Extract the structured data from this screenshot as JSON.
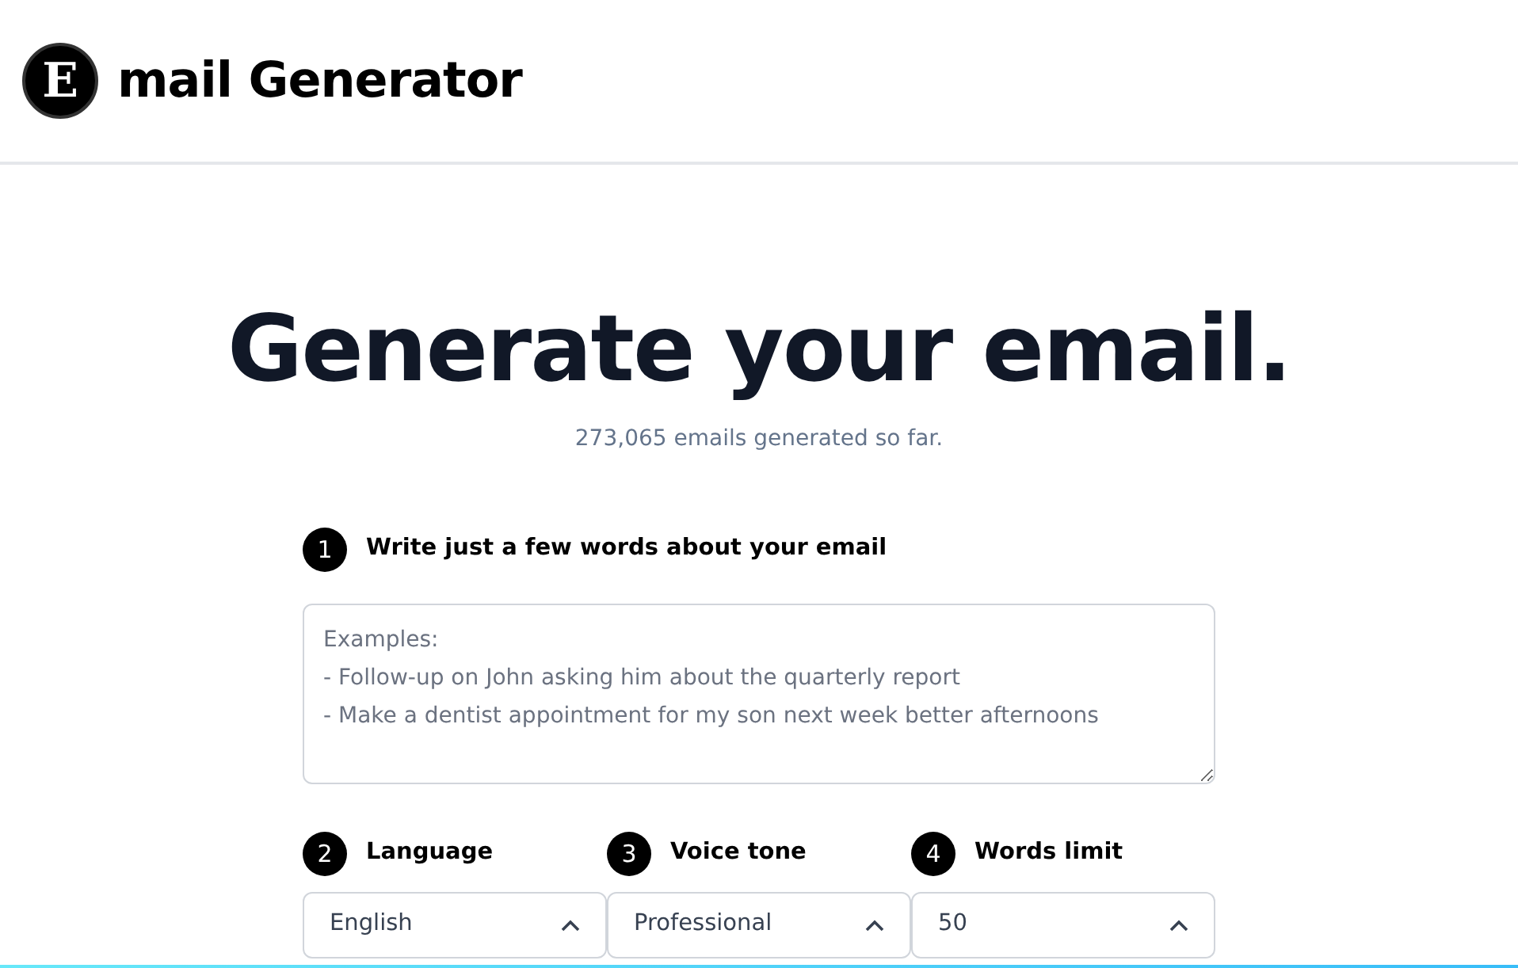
{
  "header": {
    "logo_letter": "E",
    "title": "mail Generator"
  },
  "hero": {
    "title": "Generate your email.",
    "subtitle": "273,065 emails generated so far."
  },
  "step_1": {
    "number": "1",
    "label": "Write just a few words about your email",
    "placeholder": "Examples:\n- Follow-up on John asking him about the quarterly report\n- Make a dentist appointment for my son next week better afternoons"
  },
  "selects": [
    {
      "number": "2",
      "label": "Language",
      "value": "English",
      "expanded": true
    },
    {
      "number": "3",
      "label": "Voice tone",
      "value": "Professional",
      "expanded": true
    },
    {
      "number": "4",
      "label": "Words limit",
      "value": "50",
      "expanded": true
    }
  ]
}
